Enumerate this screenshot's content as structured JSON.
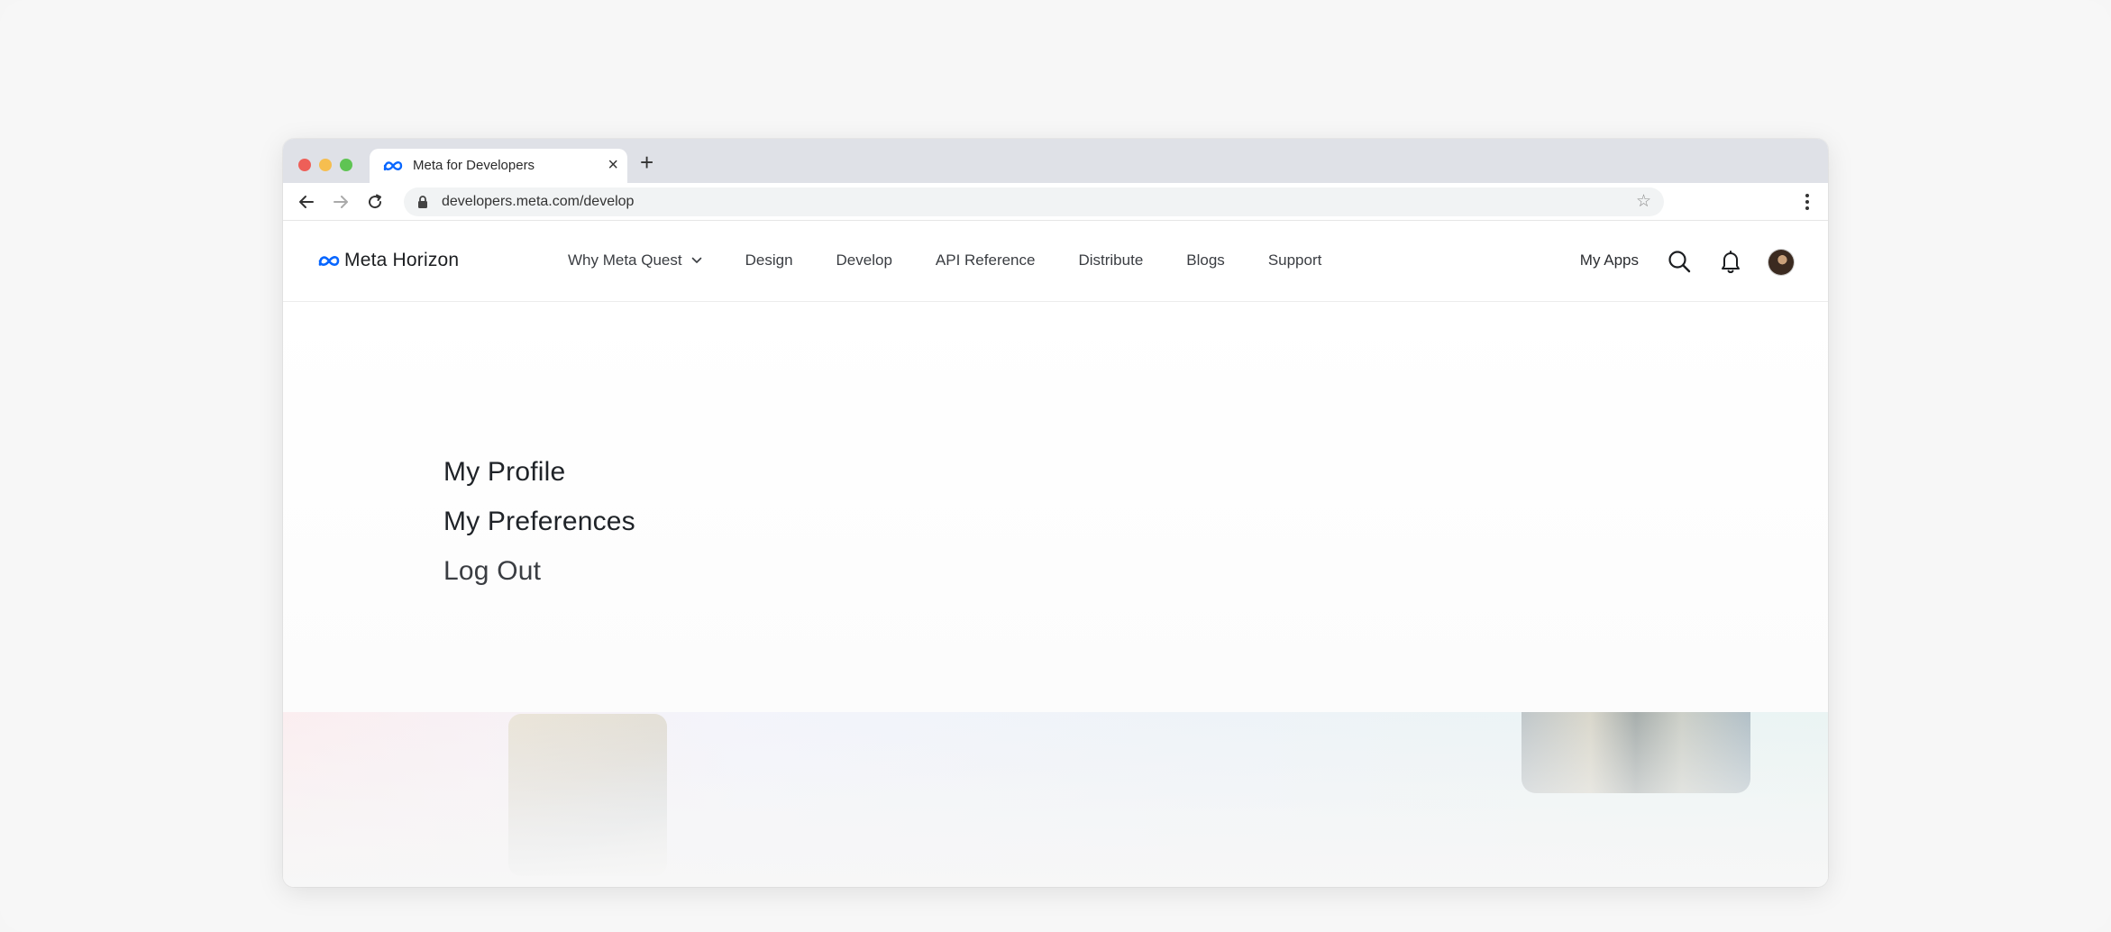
{
  "browser": {
    "tab_title": "Meta for Developers",
    "tab_close": "×",
    "new_tab": "+",
    "url": "developers.meta.com/develop",
    "bookmark_star": "☆"
  },
  "site_nav": {
    "brand": "Meta Horizon",
    "menu": [
      {
        "label": "Why Meta Quest",
        "has_dropdown": true
      },
      {
        "label": "Design"
      },
      {
        "label": "Develop"
      },
      {
        "label": "API Reference"
      },
      {
        "label": "Distribute"
      },
      {
        "label": "Blogs"
      },
      {
        "label": "Support"
      }
    ],
    "my_apps": "My Apps"
  },
  "profile_menu": {
    "items": [
      "My Profile",
      "My Preferences",
      "Log Out"
    ]
  },
  "colors": {
    "meta_blue": "#0866ff",
    "text_primary": "#1c1e21"
  },
  "icons": [
    "meta-logo-icon",
    "close-icon",
    "plus-icon",
    "back-arrow-icon",
    "forward-arrow-icon",
    "reload-icon",
    "lock-icon",
    "star-icon",
    "more-vertical-icon",
    "chevron-down-icon",
    "search-icon",
    "bell-icon",
    "avatar"
  ]
}
